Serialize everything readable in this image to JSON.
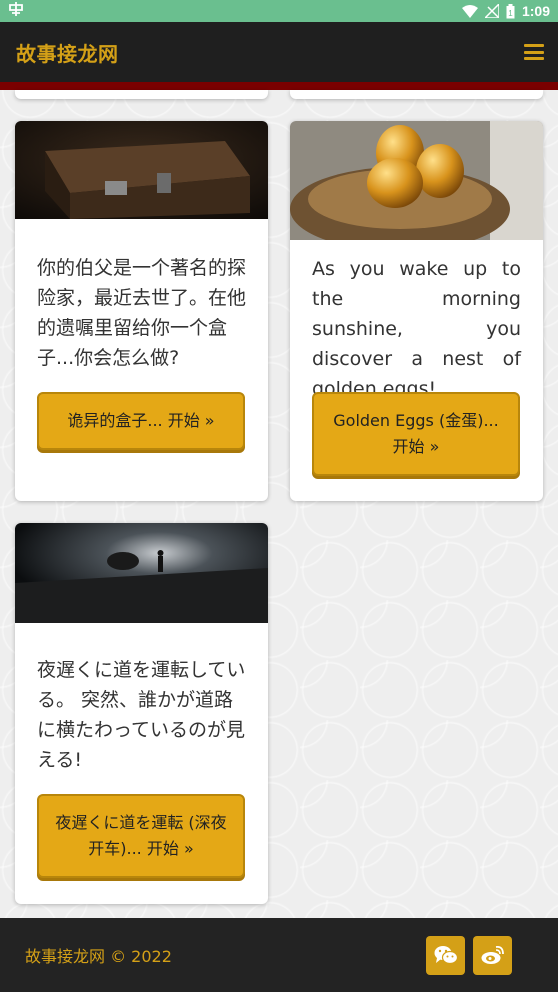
{
  "status_bar": {
    "time": "1:09"
  },
  "app": {
    "title": "故事接龙网"
  },
  "stories": [
    {
      "text": "你的伯父是一个著名的探险家，最近去世了。在他的遗嘱里留给你一个盒子...你会怎么做?",
      "button": "诡异的盒子... 开始 »"
    },
    {
      "text": "As you wake up to the morning sunshine, you discover a nest of golden eggs!",
      "button": "Golden Eggs (金蛋)... 开始 »"
    },
    {
      "text": "夜遅くに道を運転している。 突然、誰かが道路に横たわっているのが見える!",
      "button": "夜遅くに道を運転 (深夜开车)... 开始 »"
    }
  ],
  "footer": {
    "copyright": "故事接龙网 © 2022"
  },
  "icons": {
    "menu": "hamburger-menu-icon",
    "wechat": "wechat-icon",
    "weibo": "weibo-icon"
  },
  "colors": {
    "accent": "#d4a017",
    "button": "#e4a816",
    "app_bar": "#1f1f1f",
    "rule": "#7a0000",
    "status_bar": "#6abf8f"
  }
}
